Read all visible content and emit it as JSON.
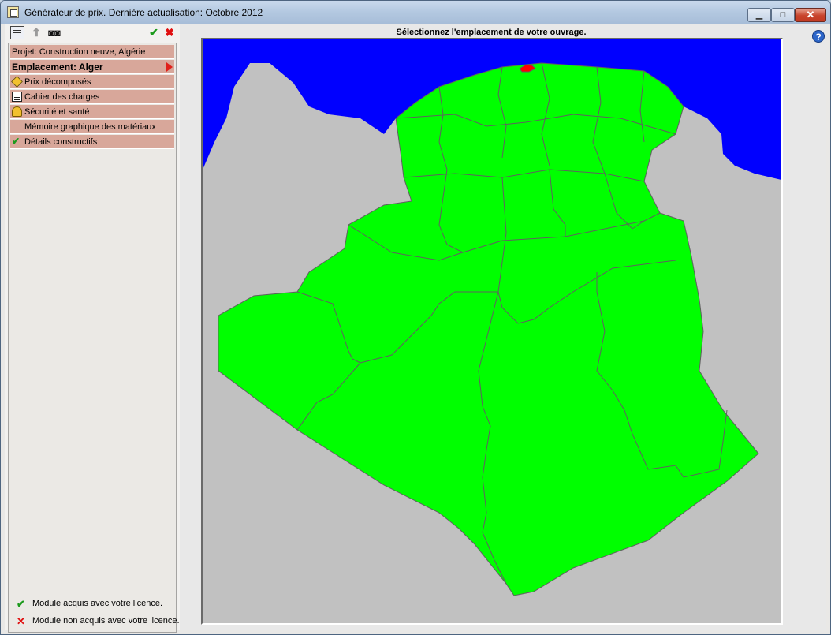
{
  "window": {
    "title": "Générateur de prix. Dernière actualisation: Octobre 2012",
    "controls": {
      "minimize": "minimize-icon",
      "maximize": "maximize-icon",
      "close": "close-icon"
    }
  },
  "toolbar": {
    "icons": [
      "document-view-icon",
      "up-arrow-icon",
      "binoculars-icon",
      "checkmark-icon",
      "cancel-icon"
    ]
  },
  "panel": {
    "project": "Projet: Construction neuve, Algérie",
    "location": "Emplacement: Alger",
    "items": [
      {
        "label": "Prix décomposés",
        "icon": "prix-decomposes-icon"
      },
      {
        "label": "Cahier des charges",
        "icon": "cahier-icon"
      },
      {
        "label": "Sécurité et santé",
        "icon": "helmet-icon"
      },
      {
        "label": "Mémoire graphique des matériaux",
        "icon": ""
      },
      {
        "label": "Détails constructifs",
        "icon": "check-icon"
      }
    ]
  },
  "legend": {
    "acquired": "Module acquis avec votre licence.",
    "not_acquired": "Module non acquis avec votre licence."
  },
  "map": {
    "title": "Sélectionnez l'emplacement de votre ouvrage.",
    "colors": {
      "sea": "#0000ff",
      "land": "#00ff00",
      "outside": "#c1c1c1",
      "selected": "#ff0000",
      "border": "#606060"
    }
  }
}
